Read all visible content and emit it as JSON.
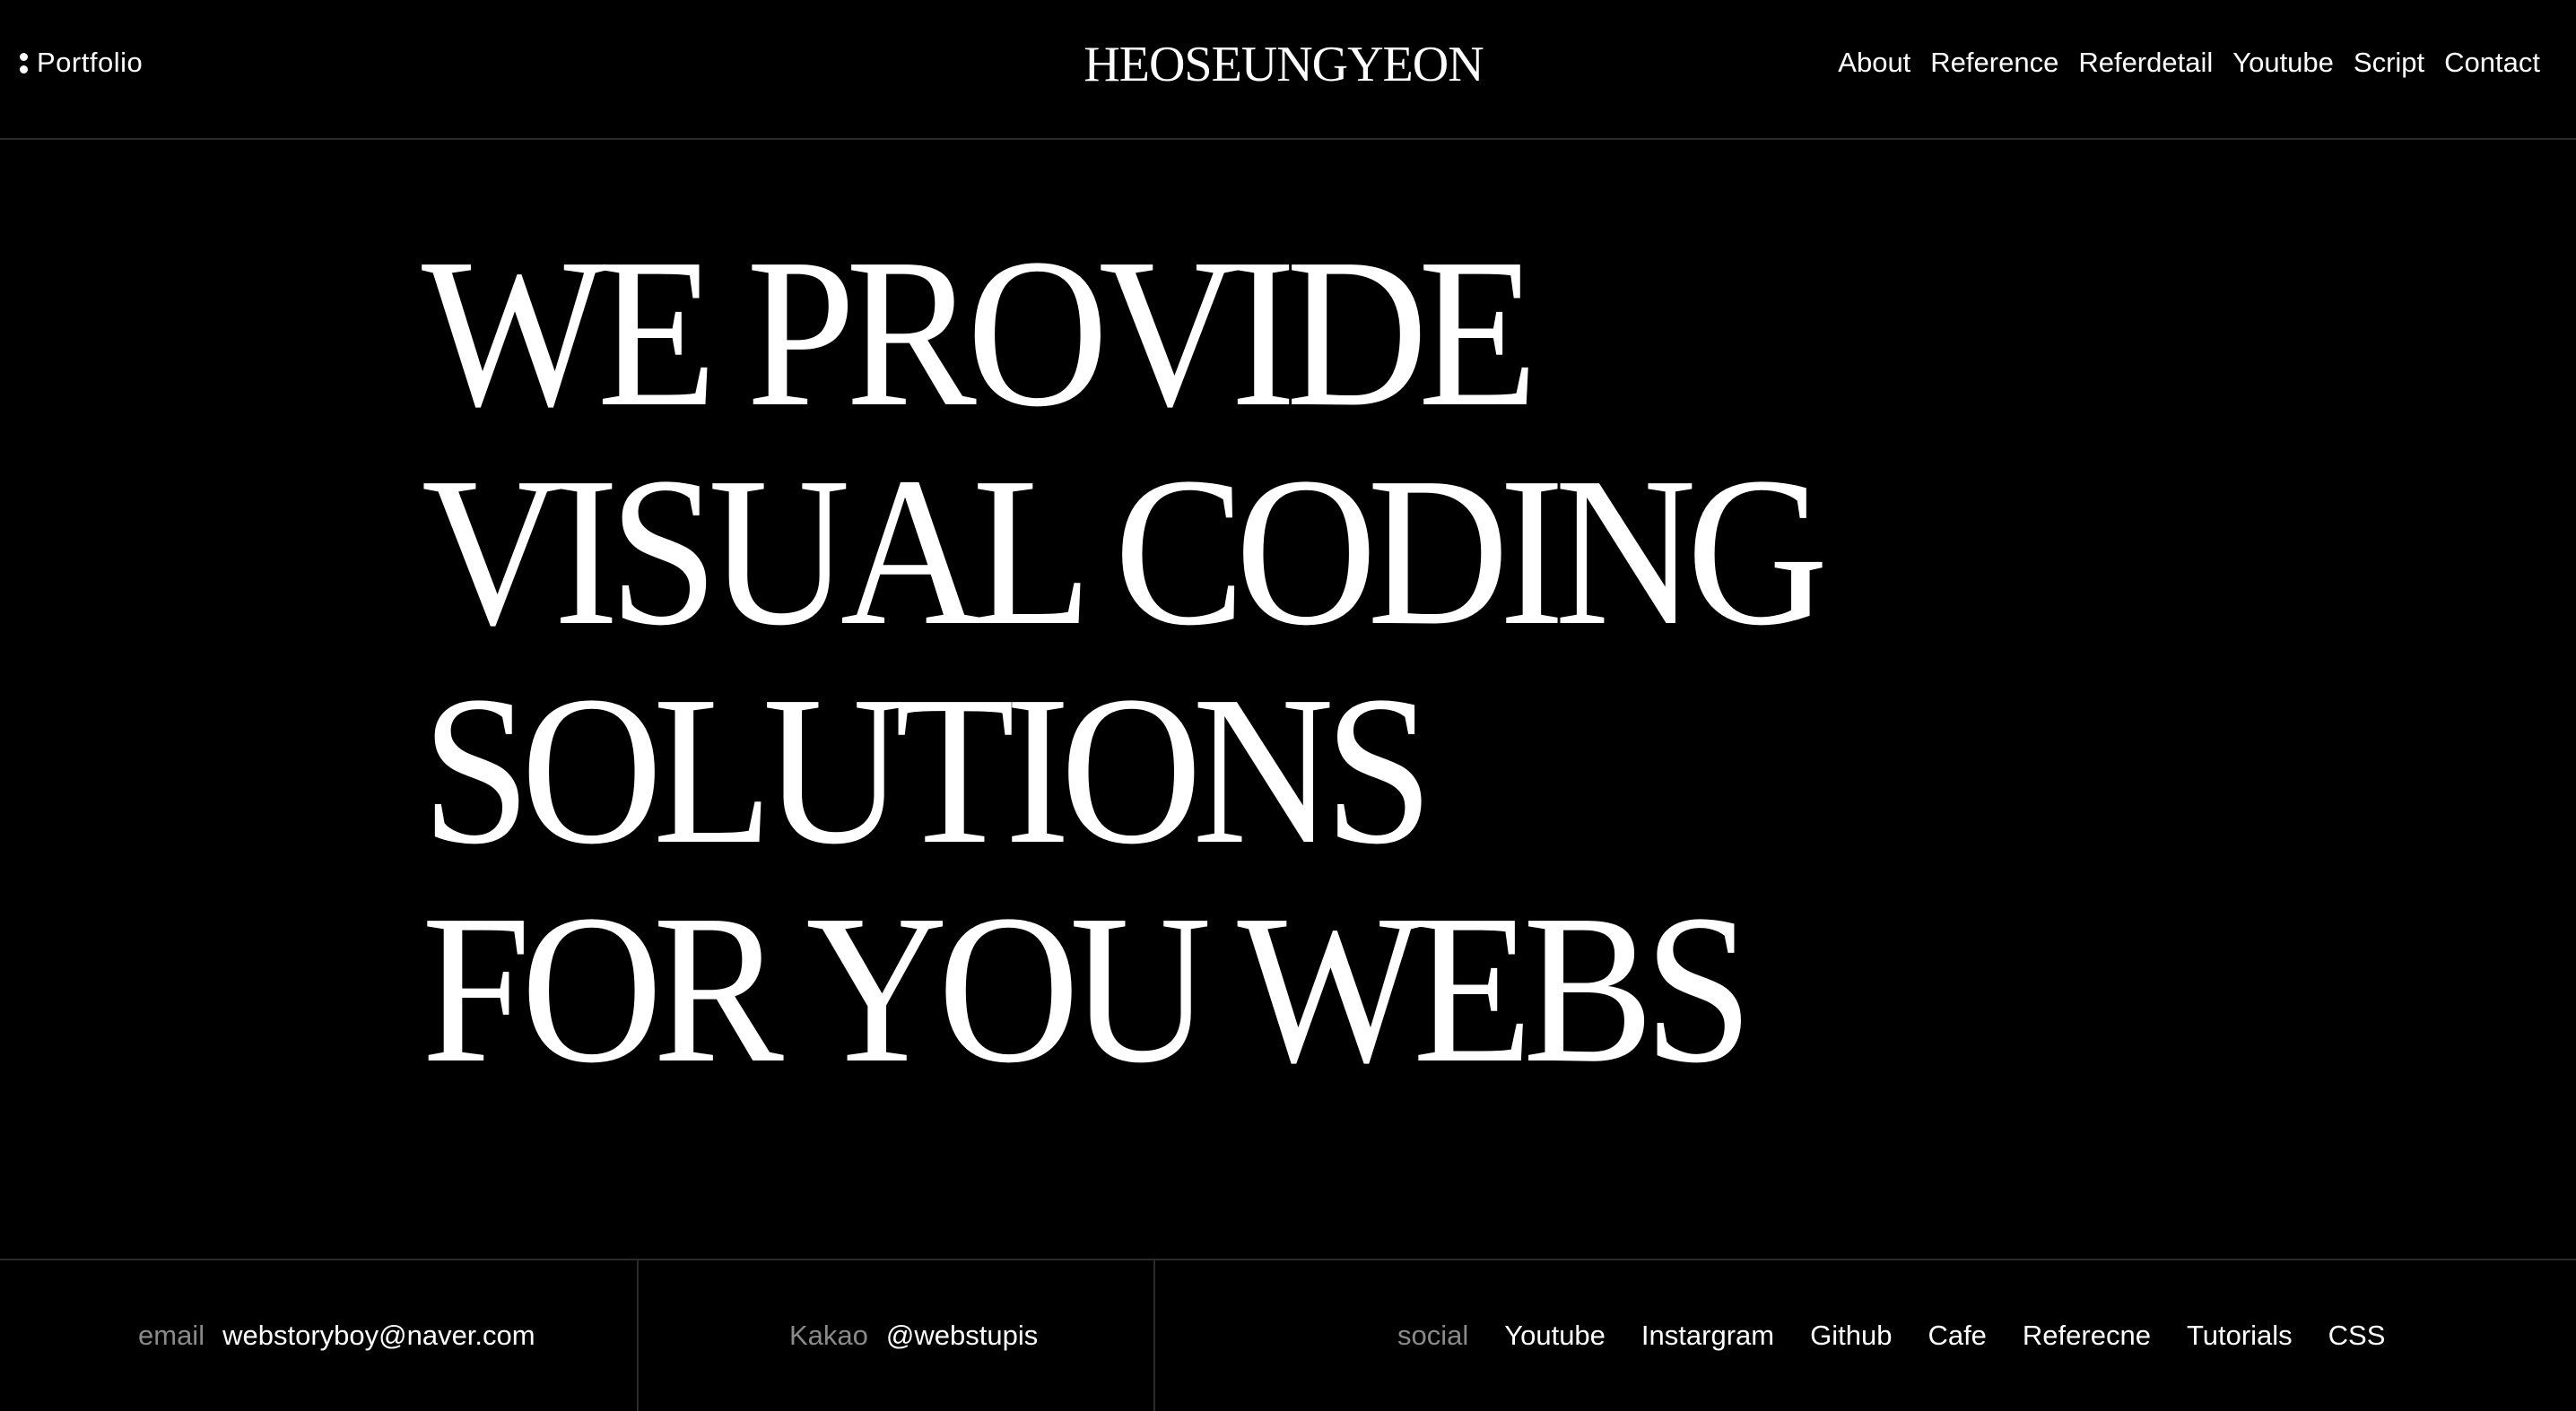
{
  "header": {
    "portfolio_label": "Portfolio",
    "site_title": "HEOSEUNGYEON",
    "nav": [
      "About",
      "Reference",
      "Referdetail",
      "Youtube",
      "Script",
      "Contact"
    ]
  },
  "hero": {
    "lines": [
      "WE PROVIDE",
      "VISUAL CODING",
      "SOLUTIONS",
      "FOR YOU WEBS"
    ]
  },
  "footer": {
    "email_label": "email",
    "email_value": "webstoryboy@naver.com",
    "kakao_label": "Kakao",
    "kakao_value": "@webstupis",
    "social_label": "social",
    "social_links": [
      "Youtube",
      "Instargram",
      "Github",
      "Cafe",
      "Referecne",
      "Tutorials",
      "CSS"
    ]
  },
  "colors": {
    "background": "#000000",
    "text": "#ffffff",
    "muted": "#8a8a8a",
    "divider": "#2a2a2a"
  }
}
